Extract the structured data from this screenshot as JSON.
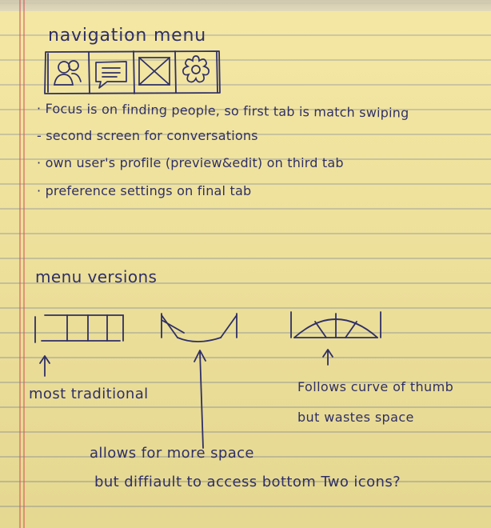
{
  "colors": {
    "paper": "#f3e59a",
    "ink": "#2f2f66",
    "margin_line": "#d25a5a"
  },
  "navigation": {
    "title": "navigation menu",
    "tabs": [
      {
        "icon": "people-icon"
      },
      {
        "icon": "chat-bubble-icon"
      },
      {
        "icon": "image-placeholder-icon"
      },
      {
        "icon": "gear-icon"
      }
    ]
  },
  "bullets": [
    "· Focus is on finding people, so first tab is match swiping",
    "- second screen for conversations",
    "· own user's profile (preview&edit) on third tab",
    "· preference settings on final tab"
  ],
  "menu_versions": {
    "title": "menu versions",
    "traditional_label": "most traditional",
    "allows_line1": "allows for more space",
    "allows_line2": "but diffiault to access bottom Two icons?",
    "follows_line1": "Follows curve of thumb",
    "follows_line2": "but wastes space"
  }
}
